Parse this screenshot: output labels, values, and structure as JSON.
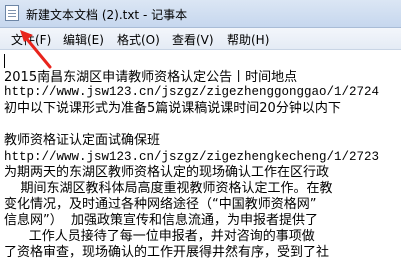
{
  "window": {
    "title": "新建文本文档 (2).txt - 记事本"
  },
  "menu": {
    "file": "文件(F)",
    "edit": "编辑(E)",
    "format": "格式(O)",
    "view": "查看(V)",
    "help": "帮助(H)"
  },
  "colors": {
    "annotation_arrow": "#e8241c"
  },
  "editor": {
    "lines": [
      "",
      "",
      "2015南昌东湖区申请教师资格认定公告丨时间地点",
      "http://www.jsw123.cn/jszgz/zigezhenggonggao/1/2724",
      "初中以下说课形式为准备5篇说课稿说课时间20分钟以内下",
      "",
      "教师资格证认定面试确保班",
      "http://www.jsw123.cn/jszgz/zigezhengkecheng/1/2723",
      "为期两天的东湖区教师资格认定的现场确认工作在区行政",
      "    期间东湖区教科体局高度重视教师资格认定工作。在教",
      "变化情况，及时通过各种网络途径（“中国教师资格网”",
      "信息网”）  加强政策宣传和信息流通，为申报者提供了",
      "      工作人员接待了每一位申报者，并对咨询的事项做",
      "了资格审查，现场确认的工作开展得井然有序，受到了社"
    ]
  }
}
